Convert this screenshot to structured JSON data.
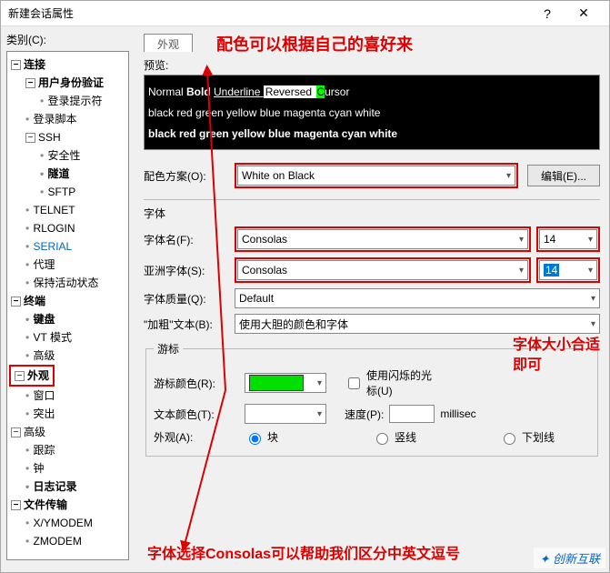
{
  "window": {
    "title": "新建会话属性",
    "help": "?",
    "close": "✕"
  },
  "category_label": "类别(C):",
  "tree": {
    "connection": "连接",
    "auth": "用户身份验证",
    "login_prompt": "登录提示符",
    "login_script": "登录脚本",
    "ssh": "SSH",
    "security": "安全性",
    "tunnel": "隧道",
    "sftp": "SFTP",
    "telnet": "TELNET",
    "rlogin": "RLOGIN",
    "serial": "SERIAL",
    "proxy": "代理",
    "keepalive": "保持活动状态",
    "terminal": "终端",
    "keyboard": "键盘",
    "vtmode": "VT 模式",
    "advanced_t": "高级",
    "appearance": "外观",
    "window_n": "窗口",
    "highlight": "突出",
    "advanced": "高级",
    "trace": "跟踪",
    "bell": "钟",
    "logging": "日志记录",
    "filetransfer": "文件传输",
    "xymodem": "X/YMODEM",
    "zmodem": "ZMODEM"
  },
  "tab": "外观",
  "preview_label": "预览:",
  "preview": {
    "normal": "Normal ",
    "bold": "Bold ",
    "underline": "Underline ",
    "reversed": "Reversed ",
    "cursor_c": "C",
    "cursor_rest": "ursor",
    "row2": "black red green yellow blue magenta cyan white",
    "row3": "black red green yellow blue magenta cyan white"
  },
  "scheme": {
    "label": "配色方案(O):",
    "value": "White on Black",
    "edit": "编辑(E)..."
  },
  "font_section": "字体",
  "font_name": {
    "label": "字体名(F):",
    "value": "Consolas",
    "size": "14"
  },
  "asian_font": {
    "label": "亚洲字体(S):",
    "value": "Consolas",
    "size": "14"
  },
  "font_quality": {
    "label": "字体质量(Q):",
    "value": "Default"
  },
  "bold_text": {
    "label": "\"加粗\"文本(B):",
    "value": "使用大胆的颜色和字体"
  },
  "cursor_section": "游标",
  "cursor_color": {
    "label": "游标颜色(R):",
    "blink": "使用闪烁的光标(U)"
  },
  "text_color": {
    "label": "文本颜色(T):",
    "speed_label": "速度(P):",
    "unit": "millisec"
  },
  "appearance_row": {
    "label": "外观(A):",
    "block": "块",
    "vline": "竖线",
    "underline": "下划线"
  },
  "annotations": {
    "top": "配色可以根据自己的喜好来",
    "right": "字体大小合适即可",
    "bottom": "字体选择Consolas可以帮助我们区分中英文逗号"
  },
  "watermark": "✦ 创新互联"
}
